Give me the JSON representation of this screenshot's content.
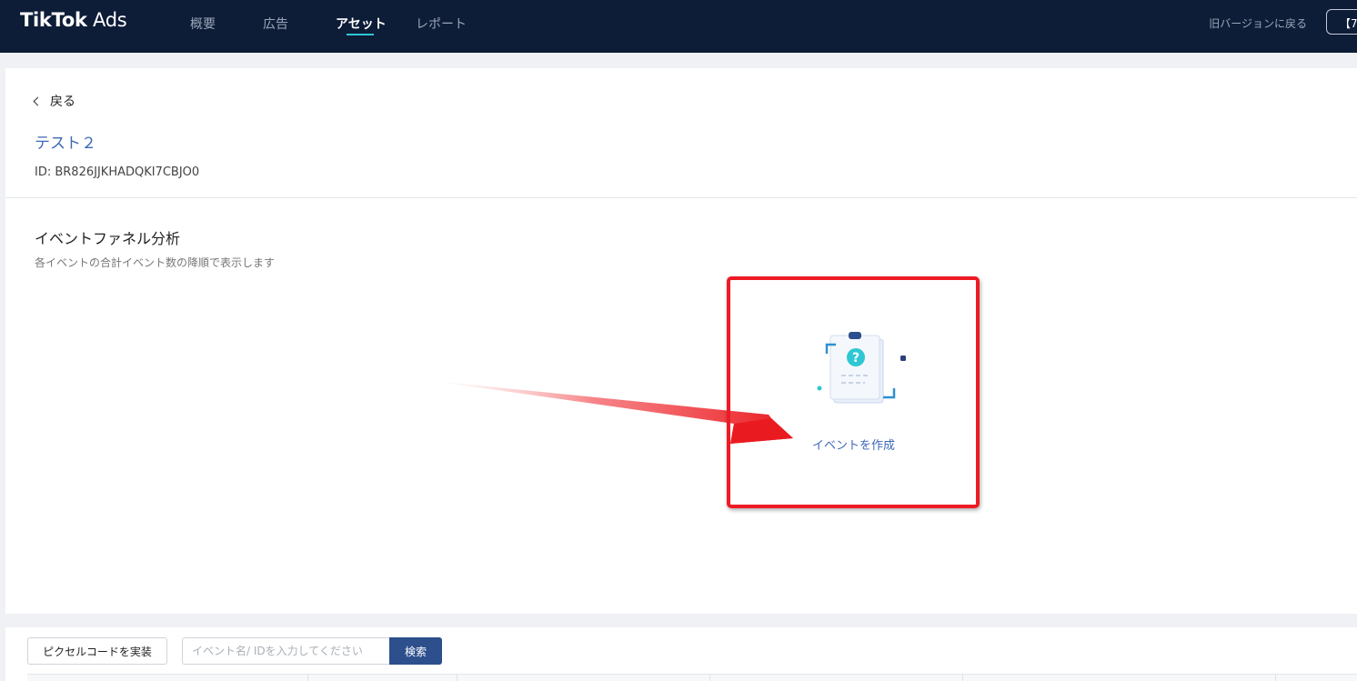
{
  "brand": {
    "logo_bold": "TikTok",
    "logo_light": "Ads"
  },
  "nav": {
    "items": [
      {
        "label": "概要"
      },
      {
        "label": "広告"
      },
      {
        "label": "アセット"
      },
      {
        "label": "レポート"
      }
    ],
    "active_index": 2,
    "old_version": "旧バージョンに戻る",
    "corner_button": "【7"
  },
  "main": {
    "back_label": "戻る",
    "pixel_name": "テスト２",
    "pixel_id": "ID: BR826JJKHADQKI7CBJO0",
    "funnel_title": "イベントファネル分析",
    "funnel_subtitle": "各イベントの合計イベント数の降順で表示します",
    "create_event_label": "イベントを作成",
    "icons": {
      "back": "chevron-left-icon",
      "empty": "clipboard-question-icon"
    }
  },
  "bottom": {
    "implement_button": "ピクセルコードを実装",
    "search_placeholder": "イベント名/ IDを入力してください",
    "search_button": "検索"
  },
  "colors": {
    "nav_bg": "#0d1c37",
    "accent": "#2ec7d3",
    "link": "#3d69b8",
    "primary_button": "#2d4f8c",
    "highlight": "#ee1b24"
  }
}
